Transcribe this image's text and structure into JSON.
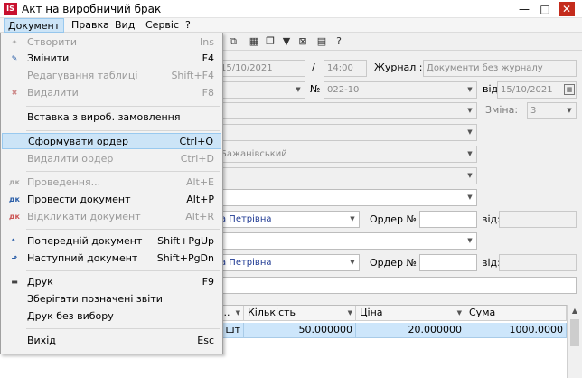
{
  "window": {
    "logo": "IS",
    "title": "Акт на виробничий брак",
    "minimize": "—",
    "maximize": "□",
    "close": "✕"
  },
  "menubar": [
    {
      "label": "Документ",
      "active": true
    },
    {
      "label": "Правка"
    },
    {
      "label": "Вид"
    },
    {
      "label": "Сервіс"
    },
    {
      "label": "?"
    }
  ],
  "toolbar_icons": [
    "copy-icon",
    "grid-icon",
    "pages-icon",
    "filter-icon",
    "clear-filter-icon",
    "doc-icon",
    "help-icon"
  ],
  "toolbar_glyphs": [
    "⧉",
    "▦",
    "❐",
    "▼",
    "⊠",
    "▤",
    "?"
  ],
  "form": {
    "date_value": "15/10/2021",
    "slash": "/",
    "time_value": "14:00",
    "journal_label": "Журнал :",
    "journal_value": "Документи без журналу",
    "number_label": "№",
    "number_value": "022-10",
    "vid_label": "від",
    "vid_date": "15/10/2021",
    "shift_label": "Зміна:",
    "shift_value": "3",
    "person_partial": "Бажанівський",
    "employee1_partial": "а Петрівна",
    "order_label": "Ордер №",
    "order_vid_label": "від:",
    "employee2_partial": "а Петрівна",
    "order2_label": "Ордер №",
    "order2_vid_label": "від:"
  },
  "table": {
    "headers": [
      {
        "label": "..."
      },
      {
        "label": "Кількість"
      },
      {
        "label": "Ціна"
      },
      {
        "label": "Сума"
      }
    ],
    "rows": [
      {
        "unit": "шт",
        "quantity": "50.000000",
        "price": "20.000000",
        "sum": "1000.0000"
      }
    ]
  },
  "document_menu": {
    "items": [
      {
        "label": "Створити",
        "shortcut": "Ins",
        "disabled": true,
        "icon": "create-icon"
      },
      {
        "label": "Змінити",
        "shortcut": "F4",
        "disabled": false,
        "icon": "edit-icon"
      },
      {
        "label": "Редагування таблиці",
        "shortcut": "Shift+F4",
        "disabled": true,
        "icon": ""
      },
      {
        "label": "Видалити",
        "shortcut": "F8",
        "disabled": true,
        "icon": "delete-icon"
      },
      {
        "label": "Вставка з вироб. замовлення",
        "shortcut": "",
        "disabled": false,
        "icon": ""
      },
      {
        "label": "Сформувати ордер",
        "shortcut": "Ctrl+O",
        "disabled": false,
        "highlight": true,
        "icon": ""
      },
      {
        "label": "Видалити ордер",
        "shortcut": "Ctrl+D",
        "disabled": true,
        "icon": ""
      },
      {
        "label": "Проведення...",
        "shortcut": "Alt+E",
        "disabled": true,
        "icon": "posting-icon"
      },
      {
        "label": "Провести документ",
        "shortcut": "Alt+P",
        "disabled": false,
        "icon": "post-document-icon"
      },
      {
        "label": "Відкликати документ",
        "shortcut": "Alt+R",
        "disabled": true,
        "icon": "revoke-document-icon"
      },
      {
        "label": "Попередній документ",
        "shortcut": "Shift+PgUp",
        "disabled": false,
        "icon": "previous-document-icon"
      },
      {
        "label": "Наступний документ",
        "shortcut": "Shift+PgDn",
        "disabled": false,
        "icon": "next-document-icon"
      },
      {
        "label": "Друк",
        "shortcut": "F9",
        "disabled": false,
        "icon": "print-icon"
      },
      {
        "label": "Зберігати позначені звіти",
        "shortcut": "",
        "disabled": false,
        "icon": ""
      },
      {
        "label": "Друк без вибору",
        "shortcut": "",
        "disabled": false,
        "icon": ""
      },
      {
        "label": "Вихід",
        "shortcut": "Esc",
        "disabled": false,
        "icon": ""
      }
    ]
  },
  "colors": {
    "highlight": "#cce4f7",
    "selected_row": "#cde6fb",
    "link_text": "#1f3a93",
    "close_button": "#c42b1c"
  }
}
